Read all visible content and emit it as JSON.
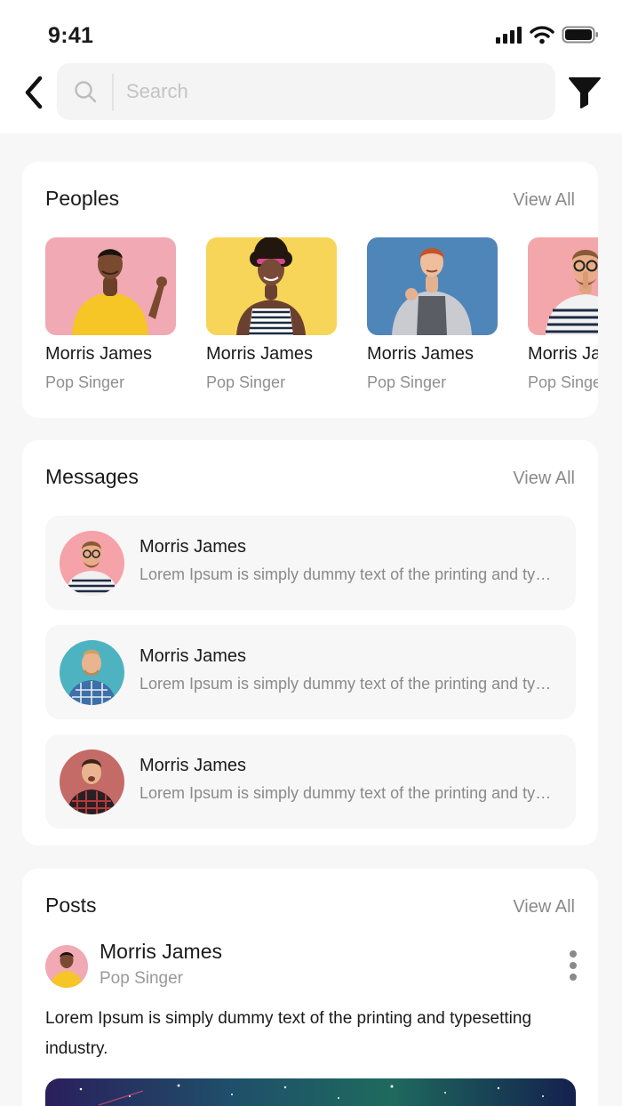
{
  "status_bar": {
    "time": "9:41",
    "icons": [
      "signal-icon",
      "wifi-icon",
      "battery-icon"
    ]
  },
  "header": {
    "back_icon": "chevron-left-icon",
    "search": {
      "placeholder": "Search",
      "value": "",
      "icon": "search-icon"
    },
    "filter_icon": "filter-icon"
  },
  "peoples": {
    "title": "Peoples",
    "view_all": "View All",
    "items": [
      {
        "name": "Morris James",
        "role": "Pop Singer",
        "bg": "#f1a9b3"
      },
      {
        "name": "Morris James",
        "role": "Pop Singer",
        "bg": "#f7d558"
      },
      {
        "name": "Morris James",
        "role": "Pop Singer",
        "bg": "#4f86ba"
      },
      {
        "name": "Morris James",
        "role": "Pop Singer",
        "bg": "#f4a7aa"
      }
    ]
  },
  "messages": {
    "title": "Messages",
    "view_all": "View All",
    "items": [
      {
        "name": "Morris James",
        "text": "Lorem Ipsum is simply dummy text of the printing and typesetting industry.",
        "bg": "#f5a3a8"
      },
      {
        "name": "Morris James",
        "text": "Lorem Ipsum is simply dummy text of the printing and typesetting industry.",
        "bg": "#4eb3c0"
      },
      {
        "name": "Morris James",
        "text": "Lorem Ipsum is simply dummy text of the printing and typesetting industry.",
        "bg": "#c46a67"
      }
    ]
  },
  "posts": {
    "title": "Posts",
    "view_all": "View All",
    "author": {
      "name": "Morris James",
      "role": "Pop Singer",
      "bg": "#f1a9b3"
    },
    "text": "Lorem Ipsum is simply dummy text of the printing and typesetting industry.",
    "menu_icon": "more-vertical-icon"
  },
  "colors": {
    "background": "#f7f7f7",
    "card": "#ffffff",
    "muted_text": "#8a8a8a",
    "primary_text": "#1a1a1a"
  }
}
